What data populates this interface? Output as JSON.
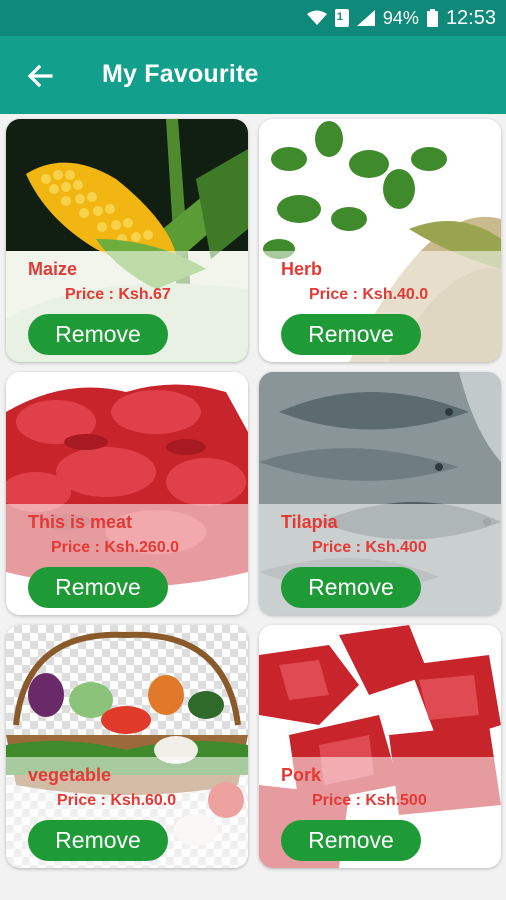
{
  "status_bar": {
    "battery": "94%",
    "time": "12:53",
    "sim_label": "1"
  },
  "header": {
    "title": "My Favourite"
  },
  "items": [
    {
      "name": "Maize",
      "price": "Price : Ksh.67",
      "remove_label": "Remove"
    },
    {
      "name": "Herb",
      "price": "Price : Ksh.40.0",
      "remove_label": "Remove"
    },
    {
      "name": "This is meat",
      "price": "Price : Ksh.260.0",
      "remove_label": "Remove"
    },
    {
      "name": "Tilapia",
      "price": "Price : Ksh.400",
      "remove_label": "Remove"
    },
    {
      "name": "vegetable",
      "price": "Price : Ksh.60.0",
      "remove_label": "Remove"
    },
    {
      "name": "Pork",
      "price": "Price : Ksh.500",
      "remove_label": "Remove"
    }
  ],
  "colors": {
    "app_bar": "#12a08c",
    "status_bar": "#0f8a7a",
    "remove_button": "#1e9b36",
    "item_text": "#e53935"
  }
}
